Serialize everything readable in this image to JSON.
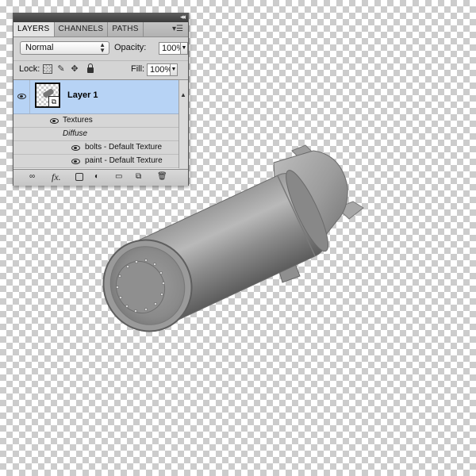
{
  "panel": {
    "tabs": [
      {
        "label": "LAYERS",
        "active": true
      },
      {
        "label": "CHANNELS",
        "active": false
      },
      {
        "label": "PATHS",
        "active": false
      }
    ],
    "blend_mode": "Normal",
    "opacity_label": "Opacity:",
    "opacity_value": "100%",
    "lock_label": "Lock:",
    "fill_label": "Fill:",
    "fill_value": "100%",
    "layer": {
      "name": "Layer 1",
      "visible": true,
      "selected": true
    },
    "effects": {
      "textures_label": "Textures",
      "diffuse_label": "Diffuse",
      "items": [
        {
          "label": "bolts - Default Texture"
        },
        {
          "label": "paint - Default Texture"
        }
      ]
    },
    "bottom_icons": [
      "link-icon",
      "fx-icon",
      "mask-icon",
      "adjustment-icon",
      "folder-icon",
      "new-layer-icon",
      "trash-icon"
    ]
  },
  "colors": {
    "selection": "#b7d3f5",
    "panel_bg": "#d4d4d4"
  }
}
